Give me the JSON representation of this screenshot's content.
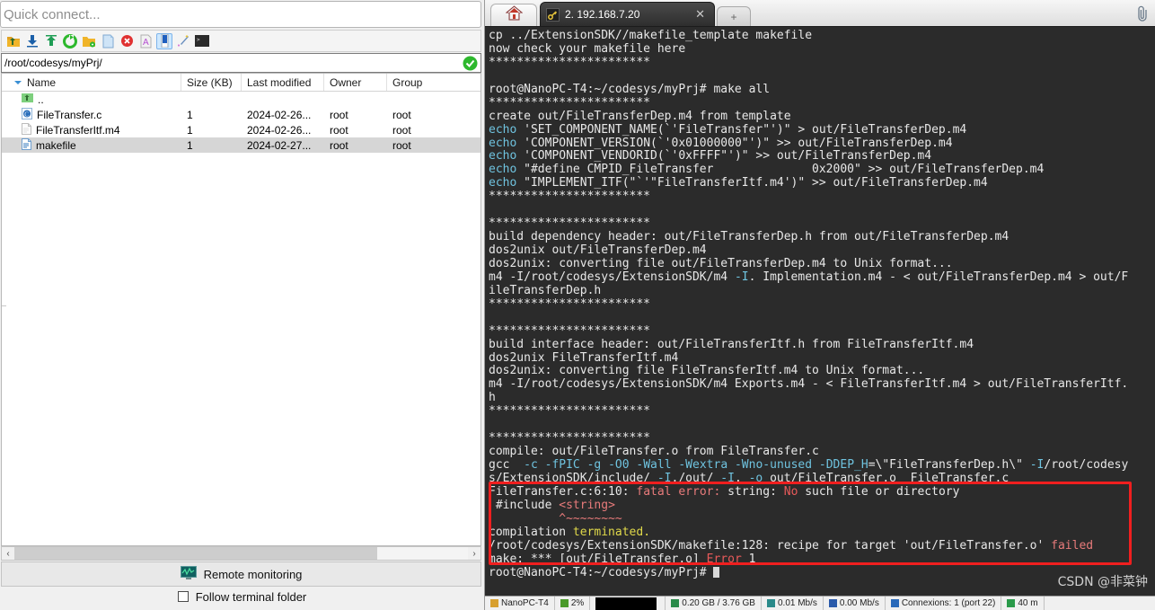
{
  "left_panel": {
    "quick_connect": {
      "placeholder": "Quick connect...",
      "value": ""
    },
    "toolbar_icons": [
      {
        "name": "go-up-folder-icon",
        "glyph": "↰"
      },
      {
        "name": "download-icon",
        "glyph": "↓"
      },
      {
        "name": "upload-icon",
        "glyph": "↑"
      },
      {
        "name": "refresh-icon",
        "glyph": "↻"
      },
      {
        "name": "new-folder-icon",
        "glyph": "▢"
      },
      {
        "name": "new-file-icon",
        "glyph": "□"
      },
      {
        "name": "delete-icon",
        "glyph": "✕"
      },
      {
        "name": "text-mode-icon",
        "glyph": "A"
      },
      {
        "name": "binary-mode-icon",
        "glyph": "▮"
      },
      {
        "name": "permissions-icon",
        "glyph": "✦"
      },
      {
        "name": "open-terminal-icon",
        "glyph": ">_"
      }
    ],
    "path_bar": {
      "value": "/root/codesys/myPrj/",
      "status_icon": "check-circle-icon"
    },
    "columns": [
      "Name",
      "Size (KB)",
      "Last modified",
      "Owner",
      "Group"
    ],
    "rows": [
      {
        "icon": "parent-folder-icon",
        "name": "..",
        "size": "",
        "modified": "",
        "owner": "",
        "group": "",
        "selected": false
      },
      {
        "icon": "c-source-file-icon",
        "name": "FileTransfer.c",
        "size": "1",
        "modified": "2024-02-26...",
        "owner": "root",
        "group": "root",
        "selected": false
      },
      {
        "icon": "plain-file-icon",
        "name": "FileTransferItf.m4",
        "size": "1",
        "modified": "2024-02-26...",
        "owner": "root",
        "group": "root",
        "selected": false
      },
      {
        "icon": "text-file-icon",
        "name": "makefile",
        "size": "1",
        "modified": "2024-02-27...",
        "owner": "root",
        "group": "root",
        "selected": true
      }
    ],
    "scroll": {
      "left_arrow": "‹",
      "right_arrow": "›"
    },
    "remote_monitoring": {
      "label": "Remote monitoring",
      "icon": "monitor-graph-icon"
    },
    "follow_terminal_folder": {
      "label": "Follow terminal folder",
      "checked": false
    }
  },
  "right_panel": {
    "tabs": {
      "home_tab": {
        "name": "home-tab",
        "icon": "house-icon"
      },
      "session_tab": {
        "label": "2. 192.168.7.20",
        "icon": "ssh-key-icon",
        "close": "✕"
      },
      "new_tab": {
        "label": "+"
      },
      "attach_icon": "paperclip-icon"
    },
    "terminal_lines": [
      [
        {
          "t": "cp ../ExtensionSDK//makefile_template makefile",
          "c": "c-white"
        }
      ],
      [
        {
          "t": "now check your makefile here",
          "c": "c-white"
        }
      ],
      [
        {
          "t": "***********************",
          "c": "c-white"
        }
      ],
      [
        {
          "t": "",
          "c": "c-white"
        }
      ],
      [
        {
          "t": "root@NanoPC-T4:~/codesys/myPrj# make all",
          "c": "c-white"
        }
      ],
      [
        {
          "t": "***********************",
          "c": "c-white"
        }
      ],
      [
        {
          "t": "create out/FileTransferDep.m4 from template",
          "c": "c-white"
        }
      ],
      [
        {
          "t": "echo",
          "c": "c-cyan"
        },
        {
          "t": " 'SET_COMPONENT_NAME(`'FileTransfer\"')\" > out/FileTransferDep.m4",
          "c": "c-white"
        }
      ],
      [
        {
          "t": "echo",
          "c": "c-cyan"
        },
        {
          "t": " 'COMPONENT_VERSION(`'0x01000000\"')\" >> out/FileTransferDep.m4",
          "c": "c-white"
        }
      ],
      [
        {
          "t": "echo",
          "c": "c-cyan"
        },
        {
          "t": " 'COMPONENT_VENDORID(`'0xFFFF\"')\" >> out/FileTransferDep.m4",
          "c": "c-white"
        }
      ],
      [
        {
          "t": "echo",
          "c": "c-cyan"
        },
        {
          "t": " \"#define CMPID_FileTransfer              0x2000\" >> out/FileTransferDep.m4",
          "c": "c-white"
        }
      ],
      [
        {
          "t": "echo",
          "c": "c-cyan"
        },
        {
          "t": " \"IMPLEMENT_ITF(\"`'\"FileTransferItf.m4')\" >> out/FileTransferDep.m4",
          "c": "c-white"
        }
      ],
      [
        {
          "t": "***********************",
          "c": "c-white"
        }
      ],
      [
        {
          "t": "",
          "c": "c-white"
        }
      ],
      [
        {
          "t": "***********************",
          "c": "c-white"
        }
      ],
      [
        {
          "t": "build dependency header: out/FileTransferDep.h from out/FileTransferDep.m4",
          "c": "c-white"
        }
      ],
      [
        {
          "t": "dos2unix out/FileTransferDep.m4",
          "c": "c-white"
        }
      ],
      [
        {
          "t": "dos2unix: converting file out/FileTransferDep.m4 to Unix format...",
          "c": "c-white"
        }
      ],
      [
        {
          "t": "m4 -I/root/codesys/ExtensionSDK/m4 ",
          "c": "c-white"
        },
        {
          "t": "-I",
          "c": "c-cyan"
        },
        {
          "t": ". Implementation.m4 - < out/FileTransferDep.m4 > out/F",
          "c": "c-white"
        }
      ],
      [
        {
          "t": "ileTransferDep.h",
          "c": "c-white"
        }
      ],
      [
        {
          "t": "***********************",
          "c": "c-white"
        }
      ],
      [
        {
          "t": "",
          "c": "c-white"
        }
      ],
      [
        {
          "t": "***********************",
          "c": "c-white"
        }
      ],
      [
        {
          "t": "build interface header: out/FileTransferItf.h from FileTransferItf.m4",
          "c": "c-white"
        }
      ],
      [
        {
          "t": "dos2unix FileTransferItf.m4",
          "c": "c-white"
        }
      ],
      [
        {
          "t": "dos2unix: converting file FileTransferItf.m4 to Unix format...",
          "c": "c-white"
        }
      ],
      [
        {
          "t": "m4 -I/root/codesys/ExtensionSDK/m4 Exports.m4 - < FileTransferItf.m4 > out/FileTransferItf.",
          "c": "c-white"
        }
      ],
      [
        {
          "t": "h",
          "c": "c-white"
        }
      ],
      [
        {
          "t": "***********************",
          "c": "c-white"
        }
      ],
      [
        {
          "t": "",
          "c": "c-white"
        }
      ],
      [
        {
          "t": "***********************",
          "c": "c-white"
        }
      ],
      [
        {
          "t": "compile: out/FileTransfer.o from FileTransfer.c",
          "c": "c-white"
        }
      ],
      [
        {
          "t": "gcc  ",
          "c": "c-white"
        },
        {
          "t": "-c",
          "c": "c-cyan"
        },
        {
          "t": " ",
          "c": "c-white"
        },
        {
          "t": "-fPIC",
          "c": "c-cyan"
        },
        {
          "t": " ",
          "c": "c-white"
        },
        {
          "t": "-g",
          "c": "c-cyan"
        },
        {
          "t": " ",
          "c": "c-white"
        },
        {
          "t": "-O0",
          "c": "c-cyan"
        },
        {
          "t": " ",
          "c": "c-white"
        },
        {
          "t": "-Wall",
          "c": "c-cyan"
        },
        {
          "t": " ",
          "c": "c-white"
        },
        {
          "t": "-Wextra",
          "c": "c-cyan"
        },
        {
          "t": " ",
          "c": "c-white"
        },
        {
          "t": "-Wno-unused",
          "c": "c-cyan"
        },
        {
          "t": " ",
          "c": "c-white"
        },
        {
          "t": "-DDEP_H",
          "c": "c-cyan"
        },
        {
          "t": "=\\\"FileTransferDep.h\\\" ",
          "c": "c-white"
        },
        {
          "t": "-I",
          "c": "c-cyan"
        },
        {
          "t": "/root/codesy",
          "c": "c-white"
        }
      ],
      [
        {
          "t": "s/ExtensionSDK/include/ ",
          "c": "c-white"
        },
        {
          "t": "-I",
          "c": "c-cyan"
        },
        {
          "t": "./out/ ",
          "c": "c-white"
        },
        {
          "t": "-I",
          "c": "c-cyan"
        },
        {
          "t": ". ",
          "c": "c-white"
        },
        {
          "t": "-o",
          "c": "c-cyan"
        },
        {
          "t": " out/FileTransfer.o  FileTransfer.c",
          "c": "c-white"
        }
      ],
      [
        {
          "t": "FileTransfer.c:6:10: ",
          "c": "c-white"
        },
        {
          "t": "fatal error: ",
          "c": "c-pink"
        },
        {
          "t": "string: ",
          "c": "c-white"
        },
        {
          "t": "No",
          "c": "c-red"
        },
        {
          "t": " such file or directory",
          "c": "c-white"
        }
      ],
      [
        {
          "t": " #include ",
          "c": "c-white"
        },
        {
          "t": "<string>",
          "c": "c-pink"
        }
      ],
      [
        {
          "t": "          ",
          "c": "c-white"
        },
        {
          "t": "^~~~~~~~~",
          "c": "c-pink"
        }
      ],
      [
        {
          "t": "compilation ",
          "c": "c-white"
        },
        {
          "t": "terminated.",
          "c": "c-yellow"
        }
      ],
      [
        {
          "t": "/root/codesys/ExtensionSDK/makefile:128: recipe for target 'out/FileTransfer.o' ",
          "c": "c-white"
        },
        {
          "t": "failed",
          "c": "c-pink"
        }
      ],
      [
        {
          "t": "make: *** [out/FileTransfer.o] ",
          "c": "c-white"
        },
        {
          "t": "Error",
          "c": "c-red"
        },
        {
          "t": " 1",
          "c": "c-white"
        }
      ],
      [
        {
          "t": "root@NanoPC-T4:~/codesys/myPrj# ",
          "c": "c-white"
        },
        {
          "t": "CURSOR",
          "c": "cursor"
        }
      ]
    ],
    "watermark": "CSDN @非菜钟",
    "status_bar": [
      {
        "icon": "host-icon",
        "label": "NanoPC-T4"
      },
      {
        "icon": "cpu-icon",
        "label": "2%"
      },
      {
        "icon": "graph-icon",
        "label": ""
      },
      {
        "icon": "memory-icon",
        "label": "0.20 GB / 3.76 GB"
      },
      {
        "icon": "download-speed-icon",
        "label": "0.01 Mb/s"
      },
      {
        "icon": "upload-speed-icon",
        "label": "0.00 Mb/s"
      },
      {
        "icon": "connections-icon",
        "label": "Connexions: 1 (port 22)"
      },
      {
        "icon": "clock-icon",
        "label": "40 m"
      }
    ]
  }
}
